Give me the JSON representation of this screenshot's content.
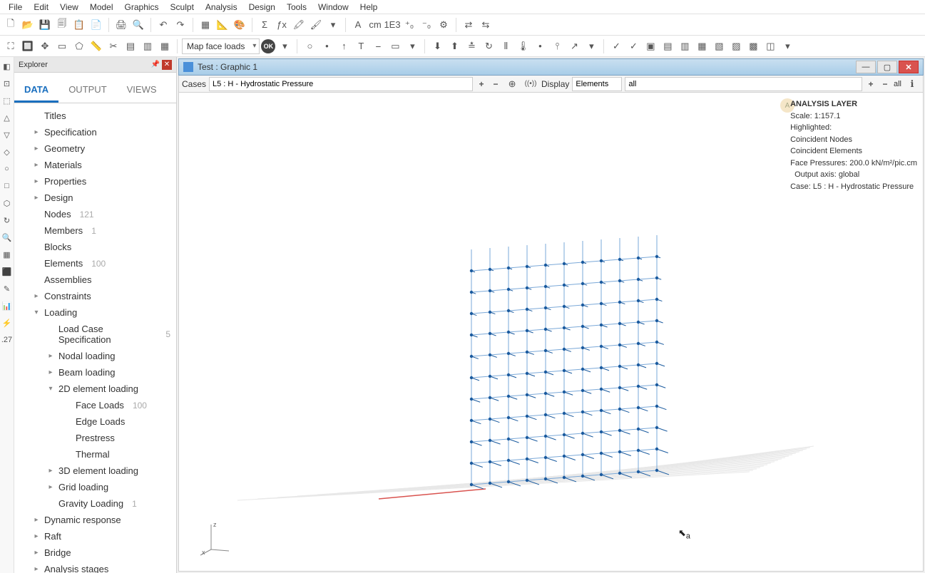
{
  "menu": [
    "File",
    "Edit",
    "View",
    "Model",
    "Graphics",
    "Sculpt",
    "Analysis",
    "Design",
    "Tools",
    "Window",
    "Help"
  ],
  "toolbar1_icons": [
    "new-file",
    "open",
    "save",
    "save-all",
    "copy",
    "paste",
    "",
    "print",
    "print-preview",
    "",
    "undo",
    "redo",
    "",
    "grid-toggle",
    "ruler",
    "color-fill",
    "",
    "sum",
    "fx",
    "highlight",
    "highlight2",
    "dropdown",
    "",
    "font-a",
    "cm",
    "1e3",
    "plus-y",
    "minus-y",
    "gear",
    "",
    "link1",
    "link2"
  ],
  "toolbar1_glyphs": [
    "🗋",
    "📂",
    "💾",
    "🗐",
    "📋",
    "📄",
    "|",
    "🖨",
    "🔍",
    "|",
    "↶",
    "↷",
    "|",
    "▦",
    "📐",
    "🎨",
    "|",
    "Σ",
    "ƒx",
    "🖍",
    "🖌",
    "▾",
    "|",
    "A",
    "cm",
    "1E3",
    "⁺₀",
    "⁻₀",
    "⚙",
    "|",
    "⇄",
    "⇆"
  ],
  "toolbar2_left_icons": [
    "zoom-extents",
    "zoom-window",
    "pan",
    "select-box",
    "select-poly",
    "measure",
    "section",
    "view-front",
    "wireframe",
    "shaded"
  ],
  "toolbar2_left_glyphs": [
    "⛶",
    "🔲",
    "✥",
    "▭",
    "⬠",
    "📏",
    "✂",
    "▤",
    "▥",
    "▦"
  ],
  "map_face_label": "Map face loads",
  "ok_label": "OK",
  "toolbar2_right_icons": [
    "circle",
    "node",
    "arrow-up",
    "text",
    "beam",
    "plate",
    "dropdown2",
    "",
    "load-down",
    "load-up",
    "support",
    "moment",
    "dist-load",
    "temp",
    "point",
    "spring",
    "vec",
    "dropdown3",
    "",
    "check1",
    "check2",
    "assy1",
    "assy2",
    "assy3",
    "assy4",
    "assy5",
    "assy6",
    "assy7",
    "assy8",
    "dropdown4"
  ],
  "toolbar2_right_glyphs": [
    "○",
    "•",
    "↑",
    "T",
    "⎯",
    "▭",
    "▾",
    "|",
    "⬇",
    "⬆",
    "≛",
    "↻",
    "⫴",
    "🌡",
    "•",
    "⫯",
    "↗",
    "▾",
    "|",
    "✓",
    "✓",
    "▣",
    "▤",
    "▥",
    "▦",
    "▧",
    "▨",
    "▩",
    "◫",
    "▾"
  ],
  "vstrip_icons": [
    "a",
    "b",
    "c",
    "d",
    "e",
    "f",
    "g",
    "h",
    "i",
    "j",
    "k",
    "l",
    "m",
    "n",
    "o",
    "p",
    "q"
  ],
  "explorer": {
    "title": "Explorer",
    "tabs": {
      "data": "DATA",
      "output": "OUTPUT",
      "views": "VIEWS"
    },
    "tree": [
      {
        "label": "Titles",
        "indent": 1
      },
      {
        "label": "Specification",
        "indent": 1,
        "exp": "▸"
      },
      {
        "label": "Geometry",
        "indent": 1,
        "exp": "▸"
      },
      {
        "label": "Materials",
        "indent": 1,
        "exp": "▸"
      },
      {
        "label": "Properties",
        "indent": 1,
        "exp": "▸"
      },
      {
        "label": "Design",
        "indent": 1,
        "exp": "▸"
      },
      {
        "label": "Nodes",
        "indent": 1,
        "count": "121"
      },
      {
        "label": "Members",
        "indent": 1,
        "count": "1"
      },
      {
        "label": "Blocks",
        "indent": 1
      },
      {
        "label": "Elements",
        "indent": 1,
        "count": "100"
      },
      {
        "label": "Assemblies",
        "indent": 1
      },
      {
        "label": "Constraints",
        "indent": 1,
        "exp": "▸"
      },
      {
        "label": "Loading",
        "indent": 1,
        "exp": "▾"
      },
      {
        "label": "Load Case Specification",
        "indent": 2,
        "count": "5"
      },
      {
        "label": "Nodal loading",
        "indent": 2,
        "exp": "▸"
      },
      {
        "label": "Beam loading",
        "indent": 2,
        "exp": "▸"
      },
      {
        "label": "2D element loading",
        "indent": 2,
        "exp": "▾"
      },
      {
        "label": "Face Loads",
        "indent": 3,
        "count": "100"
      },
      {
        "label": "Edge Loads",
        "indent": 3
      },
      {
        "label": "Prestress",
        "indent": 3
      },
      {
        "label": "Thermal",
        "indent": 3
      },
      {
        "label": "3D element loading",
        "indent": 2,
        "exp": "▸"
      },
      {
        "label": "Grid loading",
        "indent": 2,
        "exp": "▸"
      },
      {
        "label": "Gravity Loading",
        "indent": 2,
        "count": "1"
      },
      {
        "label": "Dynamic response",
        "indent": 1,
        "exp": "▸"
      },
      {
        "label": "Raft",
        "indent": 1,
        "exp": "▸"
      },
      {
        "label": "Bridge",
        "indent": 1,
        "exp": "▸"
      },
      {
        "label": "Analysis stages",
        "indent": 1,
        "exp": "▸"
      }
    ]
  },
  "graphic": {
    "title": "Test : Graphic 1",
    "cases_label": "Cases",
    "cases_value": "L5 : H - Hydrostatic Pressure",
    "display_label": "Display",
    "display_value": "Elements",
    "filter_value": "all",
    "all_label": "all"
  },
  "overlay": {
    "l1": "ANALYSIS LAYER",
    "l2": "Scale: 1:157.1",
    "l3": "Highlighted:",
    "l4": "Coincident Nodes",
    "l5": "Coincident Elements",
    "l6": "Face Pressures: 200.0 kN/m²/pic.cm",
    "l7": "Output axis: global",
    "l8": "Case: L5 : H - Hydrostatic Pressure",
    "badge": "A"
  },
  "axis": {
    "x": "x",
    "z": "z"
  },
  "cursor_sub": "a"
}
